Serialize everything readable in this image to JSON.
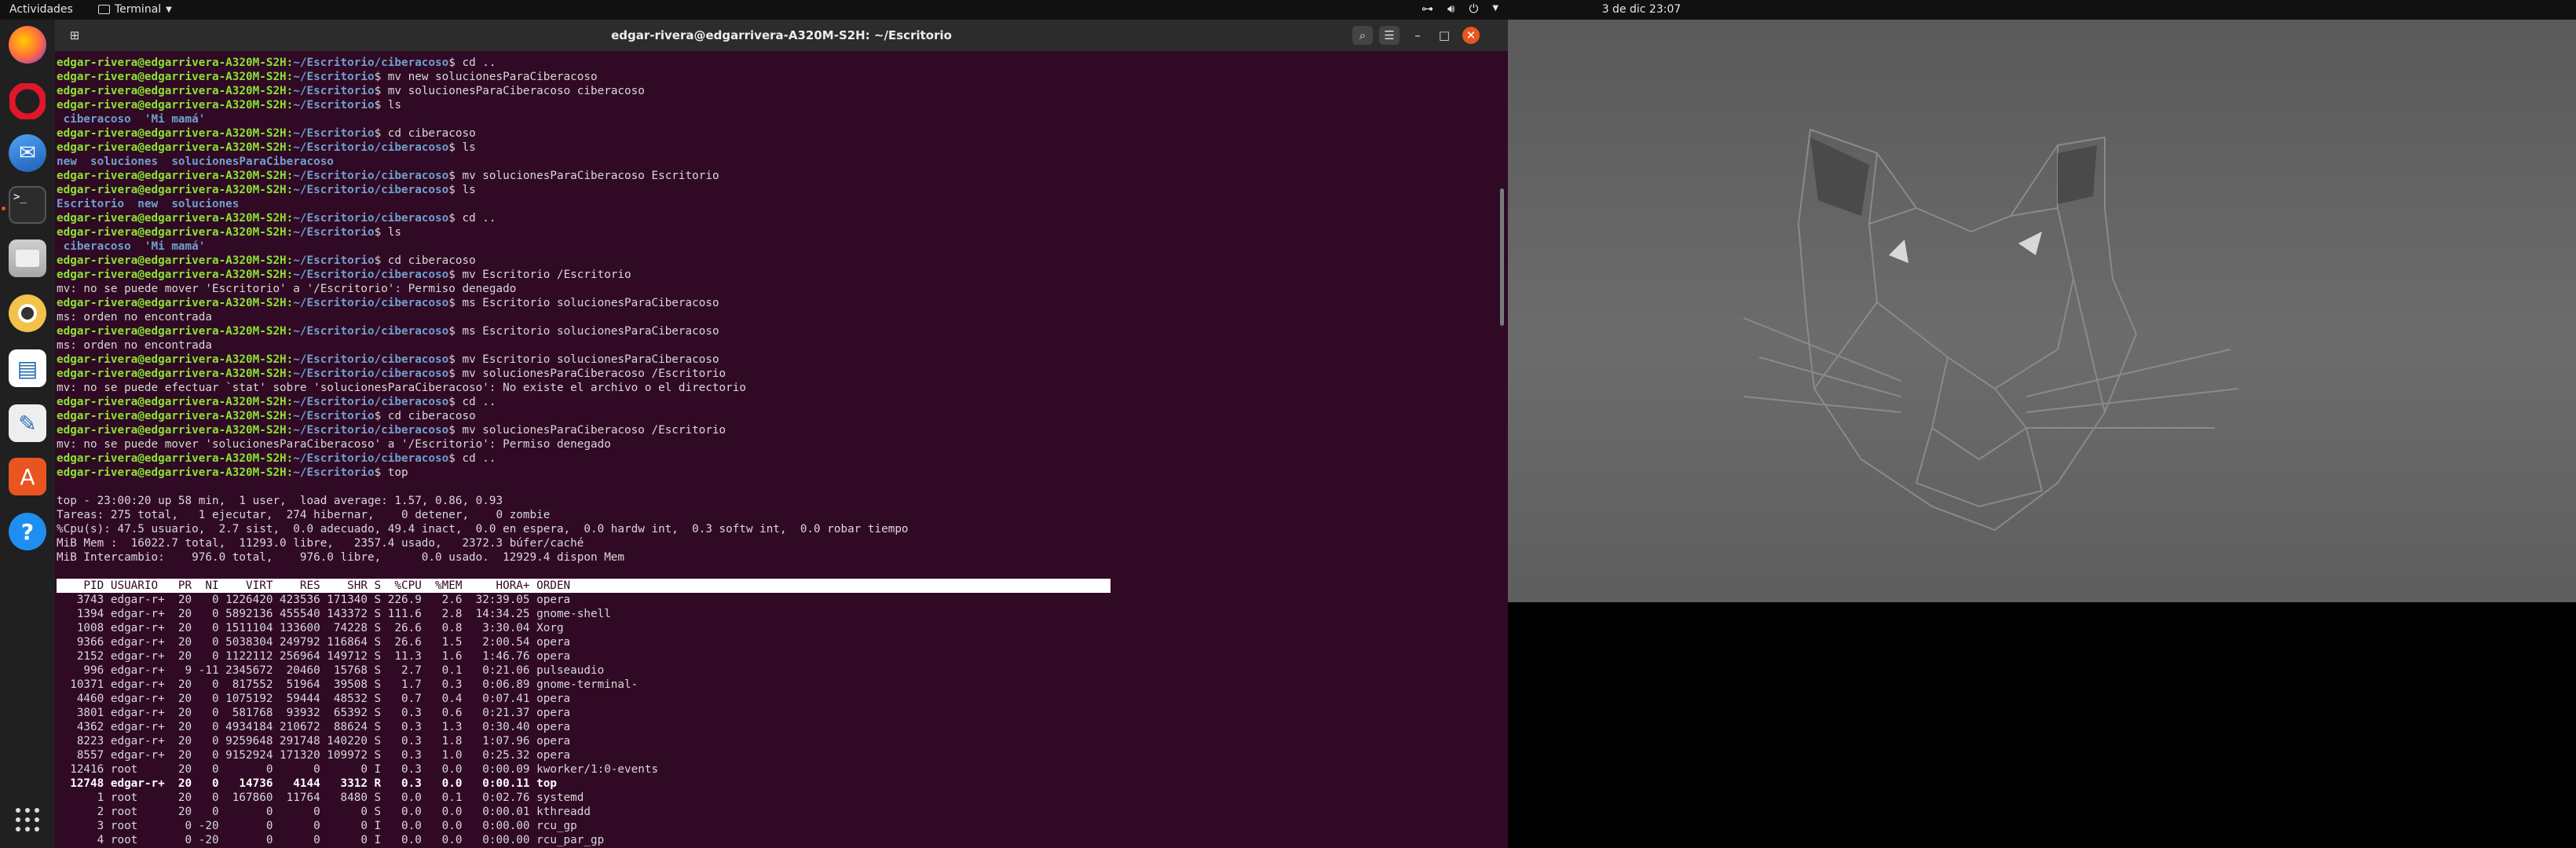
{
  "topbar": {
    "activities": "Actividades",
    "app_name": "Terminal",
    "clock": "3 de dic  23:07"
  },
  "dock": {
    "items": [
      "firefox-icon",
      "opera-icon",
      "thunderbird-icon",
      "terminal-icon",
      "files-icon",
      "rhythmbox-icon",
      "writer-icon",
      "text-editor-icon",
      "software-icon",
      "help-icon"
    ],
    "apps_grid": "show-applications-icon"
  },
  "terminal": {
    "title": "edgar-rivera@edgarrivera-A320M-S2H: ~/Escritorio",
    "prompt_user": "edgar-rivera@edgarrivera-A320M-S2H",
    "lines": [
      {
        "path": "~/Escritorio/ciberacoso",
        "cmd": "$ cd .."
      },
      {
        "path": "~/Escritorio",
        "cmd": "$ mv new solucionesParaCiberacoso"
      },
      {
        "path": "~/Escritorio",
        "cmd": "$ mv solucionesParaCiberacoso ciberacoso"
      },
      {
        "path": "~/Escritorio",
        "cmd": "$ ls"
      },
      {
        "out": " ciberacoso  'Mi mamá'",
        "dir": true
      },
      {
        "path": "~/Escritorio",
        "cmd": "$ cd ciberacoso"
      },
      {
        "path": "~/Escritorio/ciberacoso",
        "cmd": "$ ls"
      },
      {
        "out": "new  soluciones  solucionesParaCiberacoso",
        "dir": true
      },
      {
        "path": "~/Escritorio/ciberacoso",
        "cmd": "$ mv solucionesParaCiberacoso Escritorio"
      },
      {
        "path": "~/Escritorio/ciberacoso",
        "cmd": "$ ls"
      },
      {
        "out": "Escritorio  new  soluciones",
        "dir": true
      },
      {
        "path": "~/Escritorio/ciberacoso",
        "cmd": "$ cd .."
      },
      {
        "path": "~/Escritorio",
        "cmd": "$ ls"
      },
      {
        "out": " ciberacoso  'Mi mamá'",
        "dir": true
      },
      {
        "path": "~/Escritorio",
        "cmd": "$ cd ciberacoso"
      },
      {
        "path": "~/Escritorio/ciberacoso",
        "cmd": "$ mv Escritorio /Escritorio"
      },
      {
        "out": "mv: no se puede mover 'Escritorio' a '/Escritorio': Permiso denegado"
      },
      {
        "path": "~/Escritorio/ciberacoso",
        "cmd": "$ ms Escritorio solucionesParaCiberacoso"
      },
      {
        "out": "ms: orden no encontrada"
      },
      {
        "path": "~/Escritorio/ciberacoso",
        "cmd": "$ ms Escritorio solucionesParaCiberacoso"
      },
      {
        "out": "ms: orden no encontrada"
      },
      {
        "path": "~/Escritorio/ciberacoso",
        "cmd": "$ mv Escritorio solucionesParaCiberacoso"
      },
      {
        "path": "~/Escritorio/ciberacoso",
        "cmd": "$ mv solucionesParaCiberacoso /Escritorio"
      },
      {
        "out": "mv: no se puede efectuar `stat' sobre 'solucionesParaCiberacoso': No existe el archivo o el directorio"
      },
      {
        "path": "~/Escritorio/ciberacoso",
        "cmd": "$ cd .."
      },
      {
        "path": "~/Escritorio",
        "cmd": "$ cd ciberacoso"
      },
      {
        "path": "~/Escritorio/ciberacoso",
        "cmd": "$ mv solucionesParaCiberacoso /Escritorio"
      },
      {
        "out": "mv: no se puede mover 'solucionesParaCiberacoso' a '/Escritorio': Permiso denegado"
      },
      {
        "path": "~/Escritorio/ciberacoso",
        "cmd": "$ cd .."
      },
      {
        "path": "~/Escritorio",
        "cmd": "$ top"
      }
    ],
    "top_summary": [
      "top - 23:00:20 up 58 min,  1 user,  load average: 1.57, 0.86, 0.93",
      "Tareas: 275 total,   1 ejecutar,  274 hibernar,    0 detener,    0 zombie",
      "%Cpu(s): 47.5 usuario,  2.7 sist,  0.0 adecuado, 49.4 inact,  0.0 en espera,  0.0 hardw int,  0.3 softw int,  0.0 robar tiempo",
      "MiB Mem :  16022.7 total,  11293.0 libre,   2357.4 usado,   2372.3 búfer/caché",
      "MiB Intercambio:    976.0 total,    976.0 libre,      0.0 usado.  12929.4 dispon Mem"
    ],
    "table_header": "    PID USUARIO   PR  NI    VIRT    RES    SHR S  %CPU  %MEM     HORA+ ORDEN",
    "processes": [
      "   3743 edgar-r+  20   0 1226420 423536 171340 S 226.9   2.6  32:39.05 opera",
      "   1394 edgar-r+  20   0 5892136 455540 143372 S 111.6   2.8  14:34.25 gnome-shell",
      "   1008 edgar-r+  20   0 1511104 133600  74228 S  26.6   0.8   3:30.04 Xorg",
      "   9366 edgar-r+  20   0 5038304 249792 116864 S  26.6   1.5   2:00.54 opera",
      "   2152 edgar-r+  20   0 1122112 256964 149712 S  11.3   1.6   1:46.76 opera",
      "    996 edgar-r+   9 -11 2345672  20460  15768 S   2.7   0.1   0:21.06 pulseaudio",
      "  10371 edgar-r+  20   0  817552  51964  39508 S   1.7   0.3   0:06.89 gnome-terminal-",
      "   4460 edgar-r+  20   0 1075192  59444  48532 S   0.7   0.4   0:07.41 opera",
      "   3801 edgar-r+  20   0  581768  93932  65392 S   0.3   0.6   0:21.37 opera",
      "   4362 edgar-r+  20   0 4934184 210672  88624 S   0.3   1.3   0:30.40 opera",
      "   8223 edgar-r+  20   0 9259648 291748 140220 S   0.3   1.8   1:07.96 opera",
      "   8557 edgar-r+  20   0 9152924 171320 109972 S   0.3   1.0   0:25.32 opera",
      "  12416 root      20   0       0      0      0 I   0.3   0.0   0:00.09 kworker/1:0-events",
      "  12748 edgar-r+  20   0   14736   4144   3312 R   0.3   0.0   0:00.11 top",
      "      1 root      20   0  167860  11764   8480 S   0.0   0.1   0:02.76 systemd",
      "      2 root      20   0       0      0      0 S   0.0   0.0   0:00.01 kthreadd",
      "      3 root       0 -20       0      0      0 I   0.0   0.0   0:00.00 rcu_gp",
      "      4 root       0 -20       0      0      0 I   0.0   0.0   0:00.00 rcu_par_gp"
    ],
    "bold_process_index": 13
  },
  "colors": {
    "terminal_bg": "#300a24",
    "prompt_user": "#8ae234",
    "prompt_path": "#729fcf",
    "accent": "#e95420"
  }
}
